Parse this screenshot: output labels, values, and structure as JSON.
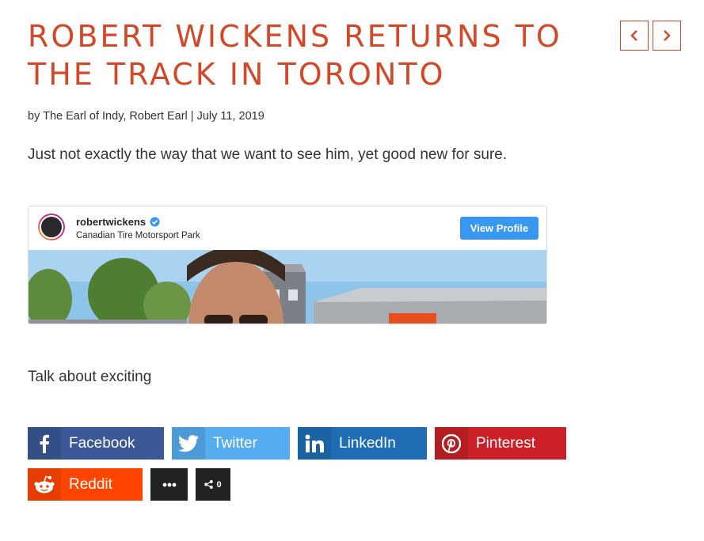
{
  "article": {
    "title": "ROBERT WICKENS RETURNS TO THE TRACK IN TORONTO",
    "byline": "by The Earl of Indy, Robert Earl | July 11, 2019",
    "lead": "Just not exactly the way that we want to see him, yet good new for sure.",
    "after_embed": "Talk about exciting"
  },
  "nav": {
    "prev_icon": "chevron-left-icon",
    "next_icon": "chevron-right-icon"
  },
  "instagram": {
    "username": "robertwickens",
    "location": "Canadian Tire Motorsport Park",
    "button": "View Profile"
  },
  "share": {
    "facebook": "Facebook",
    "twitter": "Twitter",
    "linkedin": "LinkedIn",
    "pinterest": "Pinterest",
    "reddit": "Reddit",
    "share_count": "0"
  },
  "colors": {
    "accent": "#d2492a",
    "facebook": "#3b5998",
    "twitter": "#55acee",
    "linkedin": "#1f6eb5",
    "pinterest": "#cb2027",
    "reddit": "#ff4500",
    "instagram_button": "#3897f0"
  }
}
